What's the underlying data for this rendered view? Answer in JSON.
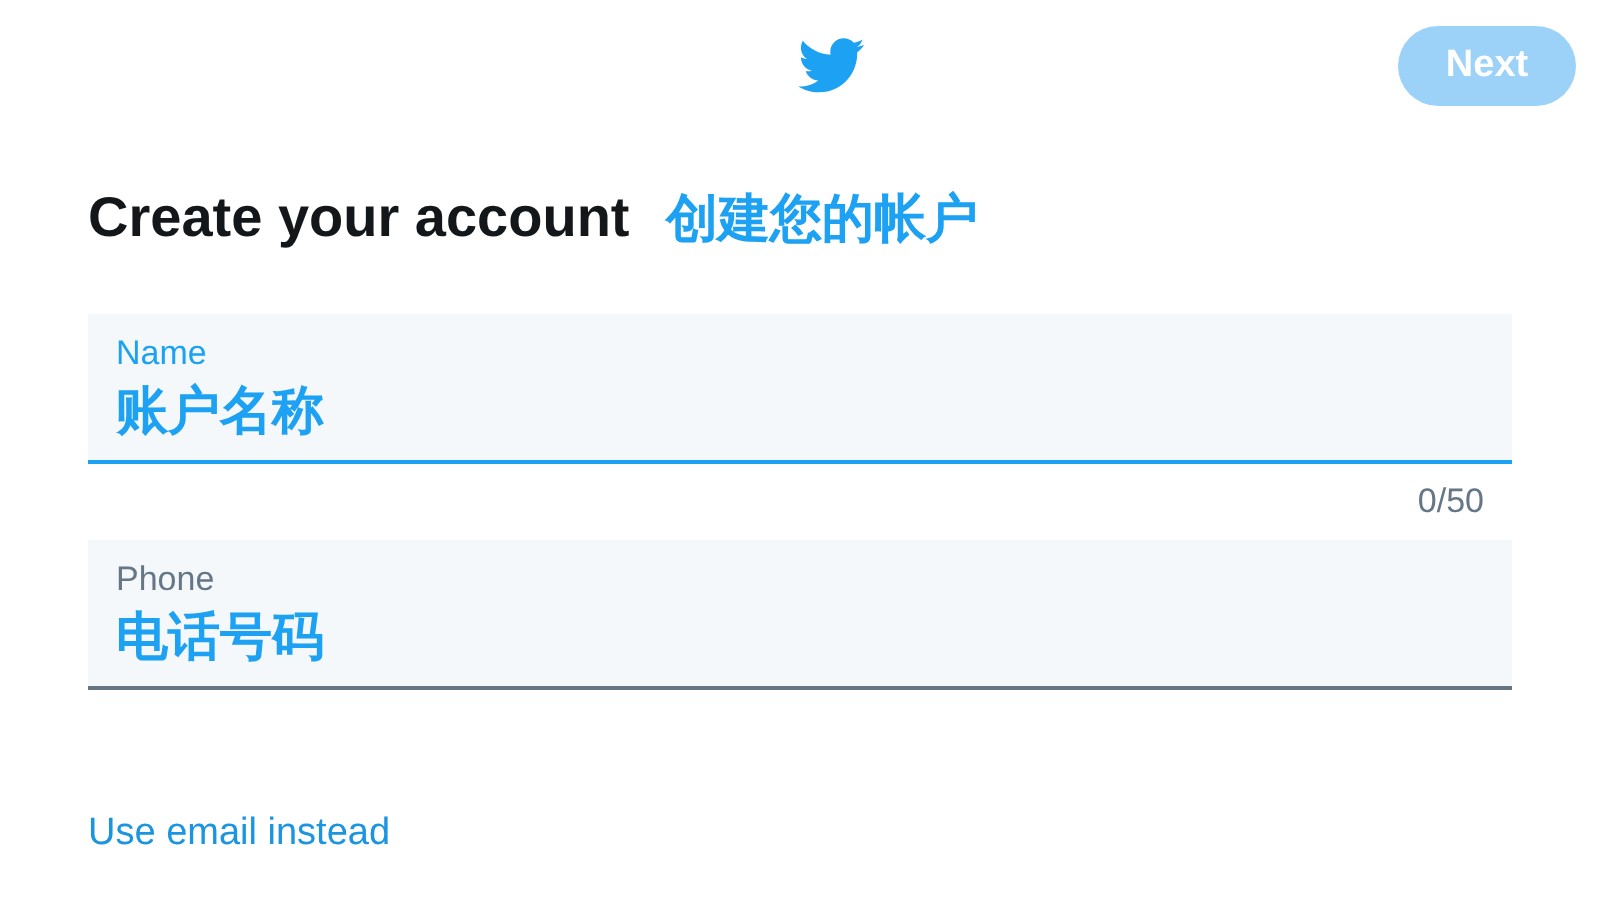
{
  "header": {
    "next_button": {
      "label": "Next",
      "disabled": true
    }
  },
  "heading": {
    "title": "Create your account",
    "annotation": "创建您的帐户"
  },
  "fields": [
    {
      "label": "Name",
      "value": "账户名称",
      "focused": true,
      "counter": "0/50"
    },
    {
      "label": "Phone",
      "value": "电话号码",
      "focused": false
    }
  ],
  "link": "Use email instead"
}
